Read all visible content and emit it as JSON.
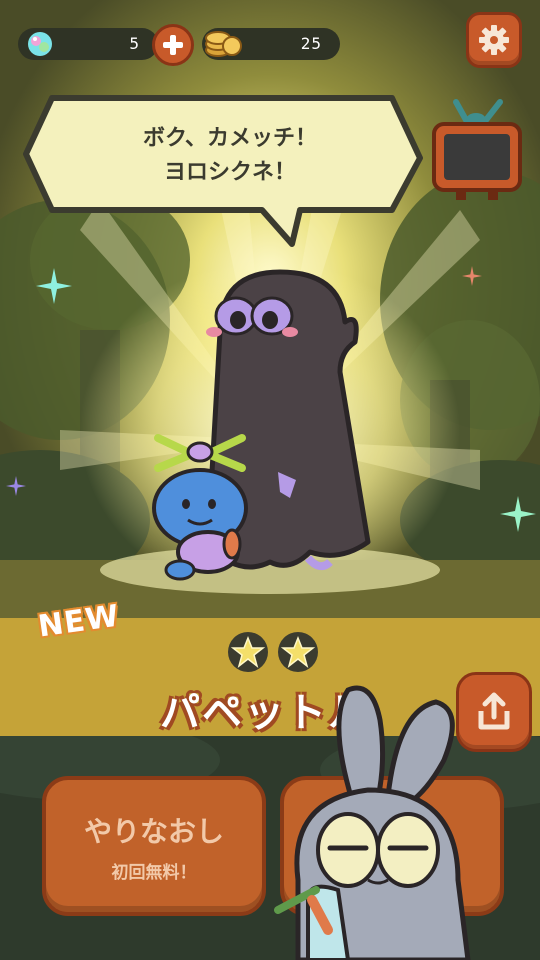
{
  "hud": {
    "gems": "5",
    "coins": "25"
  },
  "dialogue": {
    "line1": "ボク、カメッチ！",
    "line2": "ヨロシクネ！"
  },
  "character": {
    "badge": "NEW",
    "name": "パペットル",
    "stars": 2
  },
  "buttons": {
    "retry_label": "やりなおし",
    "retry_sub": "初回無料！"
  },
  "colors": {
    "accent": "#c85a2a",
    "band": "#c5a338",
    "bubble": "#f4f1bd"
  }
}
